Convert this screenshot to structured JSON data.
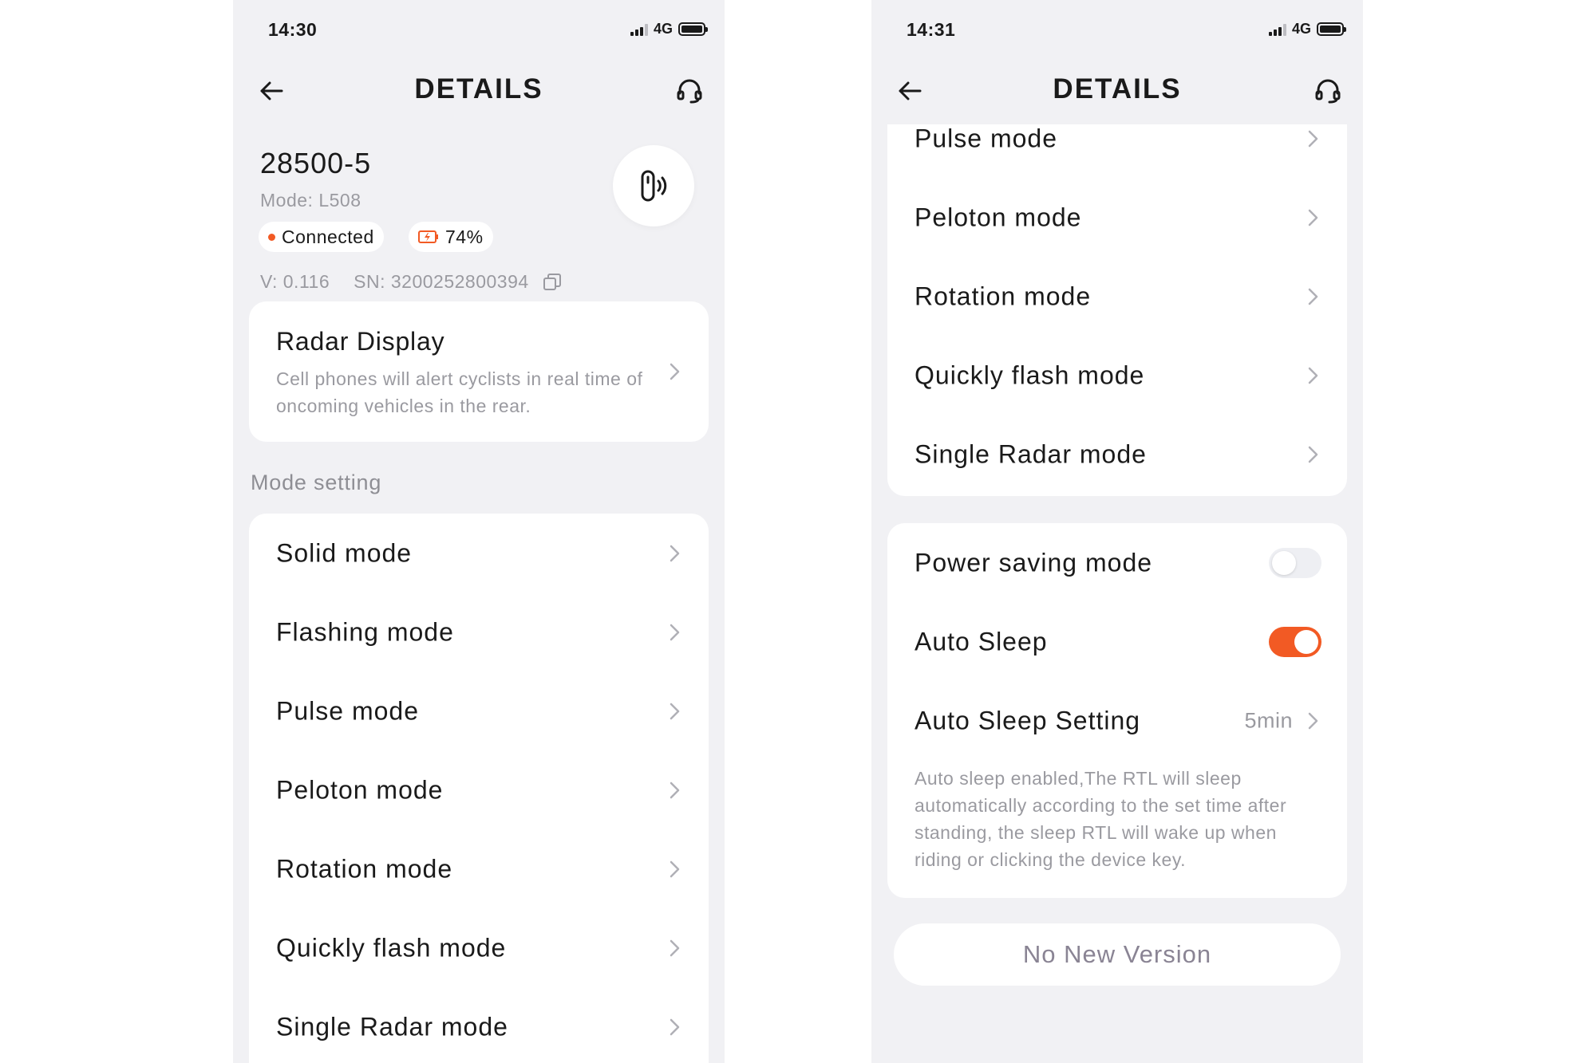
{
  "left": {
    "status": {
      "time": "14:30",
      "network": "4G"
    },
    "nav": {
      "title": "DETAILS"
    },
    "device": {
      "name": "28500-5",
      "model": "Mode: L508",
      "connection": "Connected",
      "battery": "74%",
      "version": "V: 0.116",
      "serial": "SN: 3200252800394"
    },
    "radar": {
      "title": "Radar Display",
      "description": "Cell phones will alert cyclists in real time of oncoming vehicles in the rear."
    },
    "section_label": "Mode setting",
    "modes": [
      "Solid mode",
      "Flashing mode",
      "Pulse mode",
      "Peloton mode",
      "Rotation mode",
      "Quickly flash mode",
      "Single Radar mode"
    ]
  },
  "right": {
    "status": {
      "time": "14:31",
      "network": "4G"
    },
    "nav": {
      "title": "DETAILS"
    },
    "modes": [
      "Pulse mode",
      "Peloton mode",
      "Rotation mode",
      "Quickly flash mode",
      "Single Radar mode"
    ],
    "settings": {
      "power_saving": {
        "label": "Power saving mode",
        "enabled": false
      },
      "auto_sleep": {
        "label": "Auto Sleep",
        "enabled": true
      },
      "auto_sleep_setting": {
        "label": "Auto Sleep Setting",
        "value": "5min"
      },
      "description": "Auto sleep enabled,The RTL will sleep automatically according to the set time after standing, the sleep RTL will wake up when riding or clicking the device key."
    },
    "version_button": "No New Version"
  },
  "colors": {
    "accent": "#f25a24",
    "background": "#f1f1f4",
    "muted_text": "#9a9aa0"
  }
}
